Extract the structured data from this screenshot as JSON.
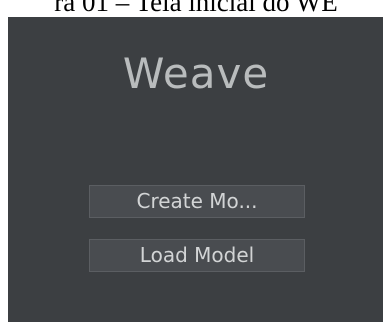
{
  "caption": "ra 01 – Tela inicial do WE",
  "app": {
    "title": "Weave"
  },
  "menu": {
    "create_label": "Create Mo...",
    "load_label": "Load Model"
  },
  "colors": {
    "window_background": "#3c3f42",
    "button_background": "#494c50",
    "title_text": "#b9bcbd",
    "button_text": "#d2d4d5"
  }
}
